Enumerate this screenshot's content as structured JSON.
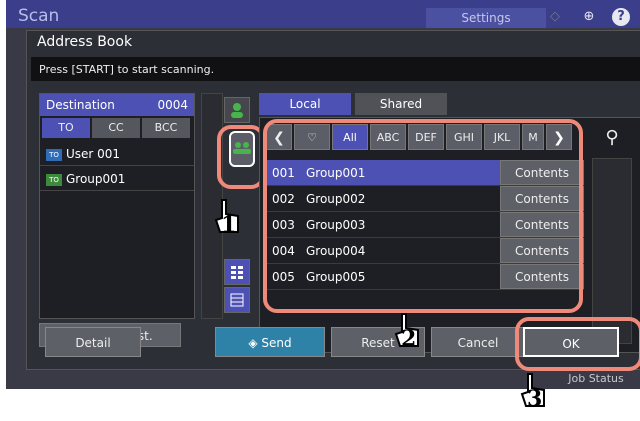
{
  "topbar": {
    "app_title": "Scan",
    "settings_label": "Settings"
  },
  "dialog": {
    "title": "Address Book",
    "message": "Press [START] to start scanning."
  },
  "destination": {
    "header_label": "Destination",
    "count": "0004",
    "tabs": [
      "TO",
      "CC",
      "BCC"
    ],
    "items": [
      {
        "name": "User 001",
        "badge": "TO"
      },
      {
        "name": "Group001",
        "badge": "TO"
      }
    ],
    "clear_label": "Clear All Dest."
  },
  "address_tabs": [
    "Local",
    "Shared"
  ],
  "filters": [
    "All",
    "ABC",
    "DEF",
    "GHI",
    "JKL",
    "M"
  ],
  "groups": [
    {
      "num": "001",
      "name": "Group001",
      "contents_label": "Contents"
    },
    {
      "num": "002",
      "name": "Group002",
      "contents_label": "Contents"
    },
    {
      "num": "003",
      "name": "Group003",
      "contents_label": "Contents"
    },
    {
      "num": "004",
      "name": "Group004",
      "contents_label": "Contents"
    },
    {
      "num": "005",
      "name": "Group005",
      "contents_label": "Contents"
    }
  ],
  "buttons": {
    "detail": "Detail",
    "send": "Send",
    "reset": "Reset",
    "cancel": "Cancel",
    "ok": "OK"
  },
  "job_status_label": "Job Status",
  "callouts": [
    "1",
    "2",
    "3"
  ],
  "colors": {
    "accent": "#4d51b4",
    "highlight": "#ef8a7a",
    "send": "#2e82a8"
  }
}
